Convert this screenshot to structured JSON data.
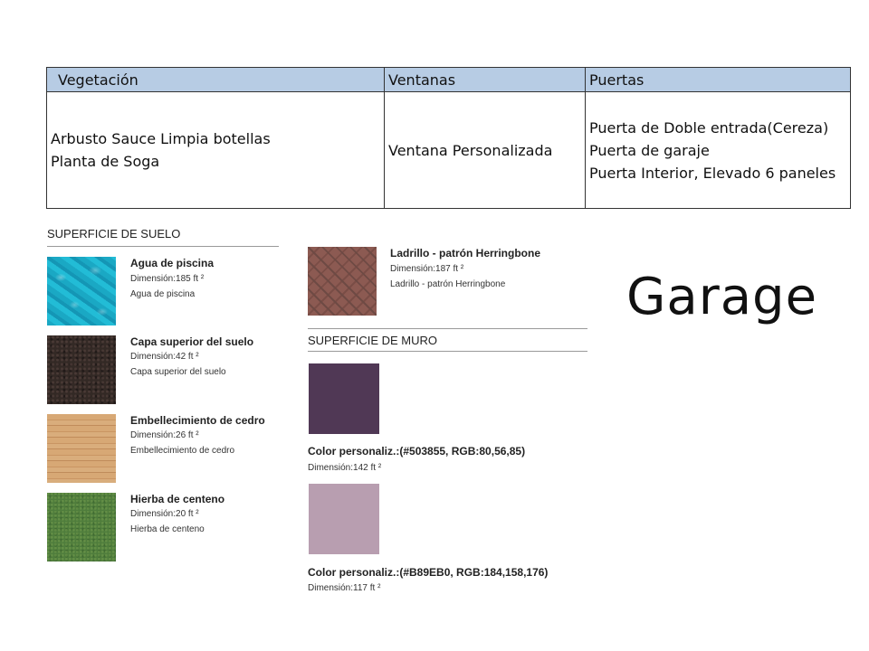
{
  "table": {
    "headers": [
      "Vegetación",
      "Ventanas",
      "Puertas"
    ],
    "vegetacion": [
      "Arbusto Sauce Limpia botellas",
      "Planta de Soga"
    ],
    "ventanas": [
      "Ventana Personalizada"
    ],
    "puertas": [
      "Puerta de Doble entrada(Cereza)",
      "Puerta de garaje",
      "Puerta Interior, Elevado 6 paneles"
    ]
  },
  "floor": {
    "title": "SUPERFICIE DE SUELO",
    "items": [
      {
        "name": "Agua de piscina",
        "dimension": "Dimensión:185 ft ²",
        "desc": "Agua de piscina"
      },
      {
        "name": "Capa superior del suelo",
        "dimension": "Dimensión:42 ft ²",
        "desc": "Capa superior del suelo"
      },
      {
        "name": "Embellecimiento de cedro",
        "dimension": "Dimensión:26 ft ²",
        "desc": "Embellecimiento de cedro"
      },
      {
        "name": "Hierba de centeno",
        "dimension": "Dimensión:20 ft ²",
        "desc": "Hierba de centeno"
      },
      {
        "name": "Ladrillo - patrón Herringbone",
        "dimension": "Dimensión:187 ft ²",
        "desc": "Ladrillo - patrón Herringbone"
      }
    ]
  },
  "wall": {
    "title": "SUPERFICIE DE MURO",
    "items": [
      {
        "name": "Color personaliz.:(#503855, RGB:80,56,85)",
        "dimension": "Dimensión:142 ft ²",
        "color": "#503855"
      },
      {
        "name": "Color personaliz.:(#B89EB0, RGB:184,158,176)",
        "dimension": "Dimensión:117 ft ²",
        "color": "#B89EB0"
      }
    ]
  },
  "room_label": "Garage",
  "colors": {
    "header_bg": "#b7cce4"
  }
}
